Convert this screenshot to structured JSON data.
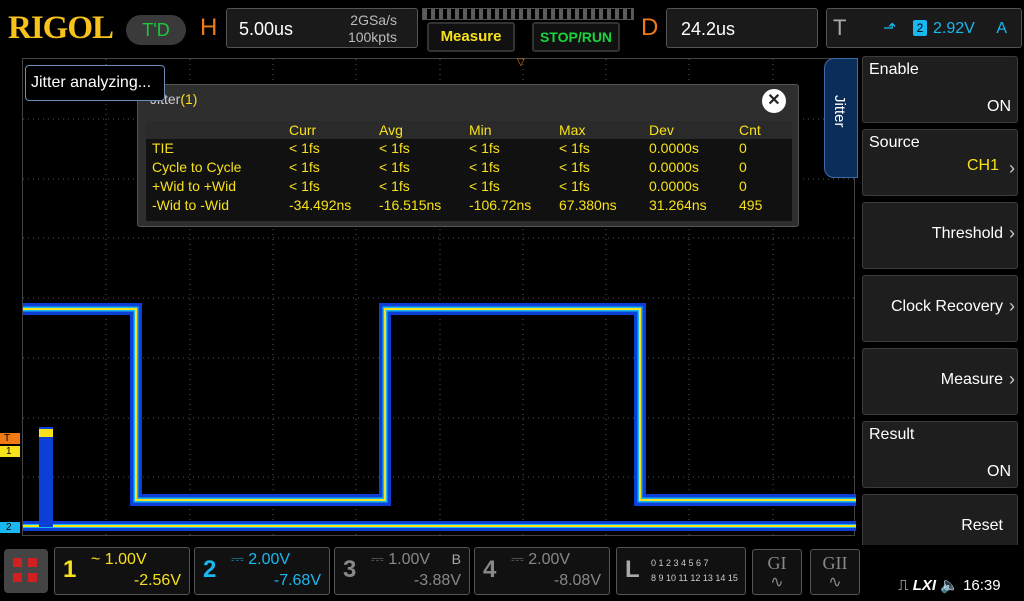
{
  "brand": "RIGOL",
  "mode_badge": "T'D",
  "horizontal": {
    "letter": "H",
    "timebase": "5.00us",
    "sample_rate": "2GSa/s",
    "points": "100kpts"
  },
  "buttons": {
    "measure": "Measure",
    "stop_run": "STOP/RUN"
  },
  "delay": {
    "letter": "D",
    "value": "24.2us"
  },
  "trigger": {
    "letter": "T",
    "level": "2.92V",
    "channel": "2",
    "mode": "A"
  },
  "analyzing_text": "Jitter analyzing...",
  "jitter_panel": {
    "title_prefix": "Jitter",
    "title_index": "(1)",
    "close": "✕",
    "columns": [
      "",
      "Curr",
      "Avg",
      "Min",
      "Max",
      "Dev",
      "Cnt"
    ],
    "rows": [
      [
        "TIE",
        "< 1fs",
        "< 1fs",
        "< 1fs",
        "< 1fs",
        "0.0000s",
        "0"
      ],
      [
        "Cycle to Cycle",
        "< 1fs",
        "< 1fs",
        "< 1fs",
        "< 1fs",
        "0.0000s",
        "0"
      ],
      [
        "+Wid to +Wid",
        "< 1fs",
        "< 1fs",
        "< 1fs",
        "< 1fs",
        "0.0000s",
        "0"
      ],
      [
        "-Wid to -Wid",
        "-34.492ns",
        "-16.515ns",
        "-106.72ns",
        "67.380ns",
        "31.264ns",
        "495"
      ]
    ]
  },
  "menu": {
    "tab": "Jitter",
    "items": [
      {
        "label": "Enable",
        "value": "ON"
      },
      {
        "label": "Source",
        "value": "CH1"
      },
      {
        "label": "Threshold"
      },
      {
        "label": "Clock Recovery"
      },
      {
        "label": "Measure"
      },
      {
        "label": "Result",
        "value": "ON"
      },
      {
        "label": "Reset"
      }
    ]
  },
  "channels": [
    {
      "num": "1",
      "scale": "1.00V",
      "offset": "-2.56V",
      "color": "#f7e11a",
      "coupling": "~"
    },
    {
      "num": "2",
      "scale": "2.00V",
      "offset": "-7.68V",
      "color": "#19b8f0",
      "coupling": "⎓"
    },
    {
      "num": "3",
      "scale": "1.00V",
      "offset": "-3.88V",
      "color": "#888888",
      "coupling": "⎓",
      "bw": "B"
    },
    {
      "num": "4",
      "scale": "2.00V",
      "offset": "-8.08V",
      "color": "#888888",
      "coupling": "⎓"
    }
  ],
  "logic": {
    "letter": "L",
    "row1": "0 1 2 3  4 5 6 7",
    "row2": "8 9 10 11 12 13 14 15"
  },
  "gen": {
    "g1": "GI",
    "g2": "GII"
  },
  "status": {
    "time": "16:39",
    "lxi": "LXI"
  },
  "markers": {
    "ch1": "1",
    "ch2": "2",
    "trig": "T"
  }
}
